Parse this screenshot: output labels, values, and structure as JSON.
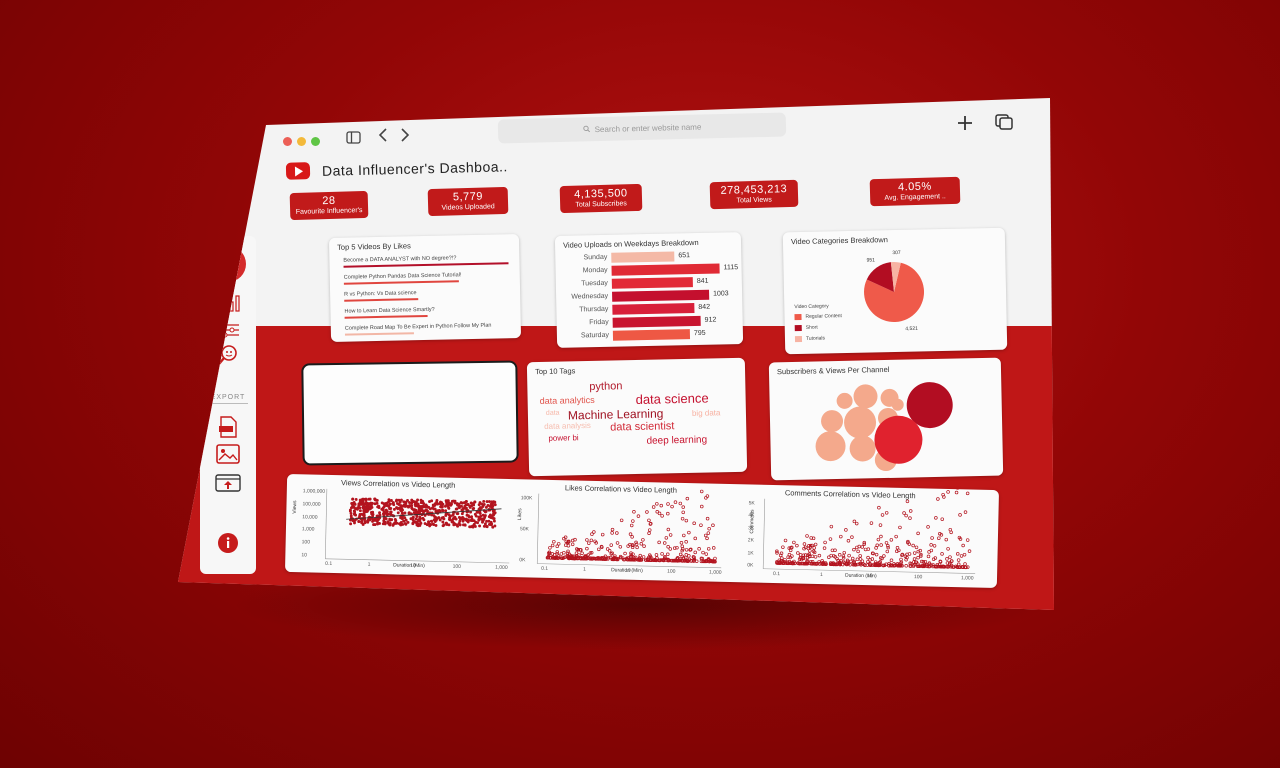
{
  "browser": {
    "url_placeholder": "Search or enter website name"
  },
  "app": {
    "title": "Data Influencer's Dashboa.."
  },
  "kpis": [
    {
      "value": "28",
      "label": "Favourite Influencer's"
    },
    {
      "value": "5,779",
      "label": "Videos Uploaded"
    },
    {
      "value": "4,135,500",
      "label": "Total Subscribes"
    },
    {
      "value": "278,453,213",
      "label": "Total Views"
    },
    {
      "value": "4.05%",
      "label": "Avg. Engagement .."
    }
  ],
  "sidebar": {
    "export_label": "EXPORT"
  },
  "top_videos": {
    "title": "Top 5 Videos By Likes",
    "items": [
      "Become a DATA ANALYST with NO degree?!?",
      "Complete Python Pandas Data Science Tutorial!",
      "R vs Python: Vs Data science",
      "How to Learn Data Science Smartly?",
      "Complete Road Map To Be Expert in Python Follow My Plan"
    ],
    "bar_fractions": [
      1.0,
      0.7,
      0.45,
      0.5,
      0.42
    ]
  },
  "weekday_chart": {
    "title": "Video Uploads on Weekdays Breakdown",
    "chart_data": {
      "type": "bar",
      "categories": [
        "Sunday",
        "Monday",
        "Tuesday",
        "Wednesday",
        "Thursday",
        "Friday",
        "Saturday"
      ],
      "values": [
        651,
        1115,
        841,
        1003,
        842,
        912,
        795
      ],
      "value_labels": [
        "651",
        "1115",
        "841",
        "1003",
        "842",
        "912",
        "795"
      ],
      "colors": [
        "#f4b9a6",
        "#e02a35",
        "#e22a37",
        "#c4102e",
        "#d8203a",
        "#c81530",
        "#ee5844"
      ]
    }
  },
  "categories_chart": {
    "title": "Video Categories Breakdown",
    "chart_data": {
      "type": "pie",
      "categories": [
        "Regular Content",
        "Short",
        "Tutorials"
      ],
      "values": [
        4521,
        951,
        307
      ],
      "value_labels": [
        "4,521",
        "951",
        "307"
      ],
      "legend_title": "Video Category",
      "colors": [
        "#ef5a4a",
        "#b20d22",
        "#f7b3a3"
      ]
    }
  },
  "tags": {
    "title": "Top 10 Tags",
    "words": [
      {
        "text": "python",
        "size": 11,
        "color": "#b11a2b"
      },
      {
        "text": "data analytics",
        "size": 9,
        "color": "#e0524a"
      },
      {
        "text": "data science",
        "size": 13,
        "color": "#c4102e"
      },
      {
        "text": "data",
        "size": 7,
        "color": "#f6b7a8"
      },
      {
        "text": "Machine Learning",
        "size": 12,
        "color": "#9e0f1f"
      },
      {
        "text": "big data",
        "size": 8,
        "color": "#f7b0a0"
      },
      {
        "text": "data analysis",
        "size": 8,
        "color": "#f6bcae"
      },
      {
        "text": "data scientist",
        "size": 11,
        "color": "#d12a37"
      },
      {
        "text": "power bi",
        "size": 8,
        "color": "#c4102e"
      },
      {
        "text": "deep learning",
        "size": 10,
        "color": "#c81530"
      }
    ]
  },
  "channels": {
    "title": "Subscribers & Views Per Channel"
  },
  "views_corr": {
    "title": "Views Correlation vs Video Length",
    "ylabel": "Views",
    "xlabel": "Duration (Min)",
    "yticks": [
      "1,000,000",
      "100,000",
      "10,000",
      "1,000",
      "100",
      "10"
    ],
    "xticks": [
      "0.1",
      "1",
      "10",
      "100",
      "1,000"
    ]
  },
  "likes_corr": {
    "title": "Likes Correlation vs Video Length",
    "ylabel": "Likes",
    "xlabel": "Duration (Min)",
    "yticks": [
      "100K",
      "50K",
      "0K"
    ],
    "xticks": [
      "0.1",
      "1",
      "10",
      "100",
      "1,000"
    ]
  },
  "comments_corr": {
    "title": "Comments Correlation vs Video Length",
    "ylabel": "Comments",
    "xlabel": "Duration (Min)",
    "yticks": [
      "5K",
      "4K",
      "3K",
      "2K",
      "1K",
      "0K"
    ],
    "xticks": [
      "0.1",
      "1",
      "10",
      "100",
      "1,000"
    ]
  }
}
